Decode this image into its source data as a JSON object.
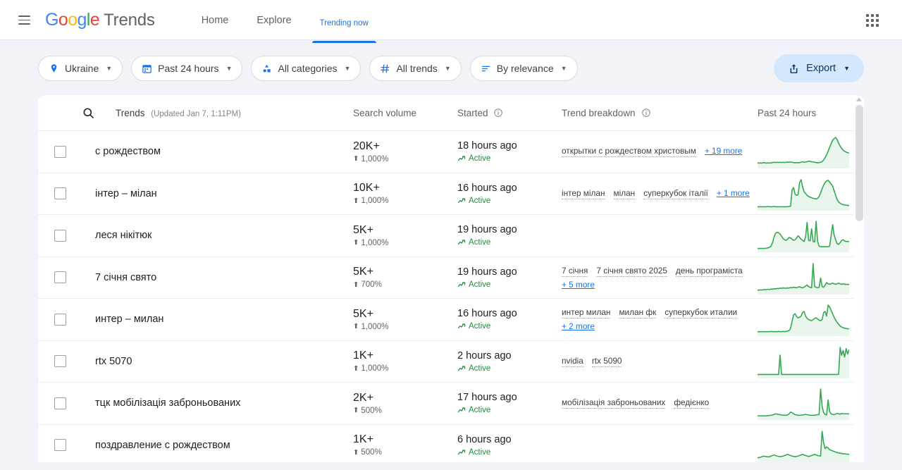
{
  "header": {
    "menu_icon": "hamburger-menu-icon",
    "logo_text": "Google",
    "logo_suffix": "Trends",
    "apps_icon": "apps-grid-icon",
    "nav": [
      {
        "label": "Home",
        "active": false
      },
      {
        "label": "Explore",
        "active": false
      },
      {
        "label": "Trending now",
        "active": true
      }
    ]
  },
  "filters": {
    "chips": [
      {
        "label": "Ukraine",
        "icon": "location-pin-icon"
      },
      {
        "label": "Past 24 hours",
        "icon": "calendar-icon"
      },
      {
        "label": "All categories",
        "icon": "categories-icon"
      },
      {
        "label": "All trends",
        "icon": "hash-icon"
      },
      {
        "label": "By relevance",
        "icon": "sort-icon"
      }
    ],
    "export": {
      "label": "Export",
      "icon": "export-upload-icon"
    }
  },
  "table": {
    "search_icon": "search-icon",
    "columns": {
      "trends": "Trends",
      "updated": "(Updated Jan 7, 1:11PM)",
      "search_volume": "Search volume",
      "started": "Started",
      "trend_breakdown": "Trend breakdown",
      "timeframe": "Past 24 hours"
    },
    "rows": [
      {
        "term": "с рождеством",
        "volume": "20K+",
        "change": "1,000%",
        "started": "18 hours ago",
        "status": "Active",
        "breakdown": [
          "открытки с рождеством христовым"
        ],
        "more": "+ 19 more",
        "spark": [
          12,
          11,
          12,
          11,
          13,
          12,
          11,
          12,
          11,
          12,
          13,
          14,
          13,
          14,
          13,
          14,
          13,
          14,
          13,
          14,
          15,
          14,
          15,
          14,
          13,
          12,
          13,
          12,
          13,
          14,
          16,
          14,
          15,
          16,
          18,
          17,
          16,
          15,
          14,
          13,
          12,
          13,
          14,
          16,
          22,
          30,
          40,
          52,
          66,
          78,
          90,
          96,
          100,
          92,
          80,
          70,
          62,
          56,
          52,
          49,
          47,
          46
        ]
      },
      {
        "term": "інтер – мілан",
        "volume": "10K+",
        "change": "1,000%",
        "started": "16 hours ago",
        "status": "Active",
        "breakdown": [
          "інтер мілан",
          "мілан",
          "суперкубок італії"
        ],
        "more": "+ 1 more",
        "spark": [
          6,
          6,
          6,
          6,
          6,
          6,
          6,
          7,
          6,
          6,
          6,
          7,
          6,
          6,
          6,
          6,
          6,
          6,
          6,
          6,
          6,
          7,
          8,
          62,
          70,
          48,
          44,
          46,
          86,
          96,
          72,
          56,
          50,
          44,
          40,
          38,
          36,
          34,
          33,
          32,
          34,
          40,
          52,
          66,
          78,
          86,
          92,
          94,
          88,
          82,
          74,
          60,
          44,
          30,
          22,
          18,
          15,
          13,
          12,
          11,
          11,
          10
        ]
      },
      {
        "term": "леся нікітюк",
        "volume": "5K+",
        "change": "1,000%",
        "started": "19 hours ago",
        "status": "Active",
        "breakdown": [],
        "more": "",
        "spark": [
          6,
          6,
          6,
          6,
          6,
          6,
          7,
          8,
          10,
          14,
          26,
          46,
          58,
          62,
          60,
          56,
          48,
          40,
          36,
          34,
          38,
          44,
          42,
          38,
          34,
          36,
          42,
          50,
          44,
          38,
          34,
          30,
          46,
          96,
          34,
          32,
          74,
          30,
          28,
          100,
          30,
          14,
          12,
          12,
          12,
          12,
          12,
          12,
          14,
          50,
          88,
          52,
          36,
          22,
          20,
          26,
          34,
          36,
          32,
          30,
          30,
          30
        ]
      },
      {
        "term": "7 січня свято",
        "volume": "5K+",
        "change": "700%",
        "started": "19 hours ago",
        "status": "Active",
        "breakdown": [
          "7 січня",
          "7 січня свято 2025",
          "день програміста"
        ],
        "more": "+ 5 more",
        "spark": [
          8,
          8,
          9,
          8,
          10,
          9,
          10,
          11,
          10,
          12,
          11,
          13,
          12,
          14,
          13,
          15,
          14,
          16,
          15,
          14,
          16,
          15,
          17,
          16,
          18,
          17,
          16,
          18,
          20,
          17,
          16,
          18,
          22,
          26,
          20,
          18,
          16,
          100,
          20,
          18,
          16,
          18,
          50,
          20,
          18,
          26,
          34,
          30,
          28,
          30,
          32,
          30,
          28,
          30,
          32,
          30,
          28,
          30,
          28,
          28,
          28,
          28
        ]
      },
      {
        "term": "интер – милан",
        "volume": "5K+",
        "change": "1,000%",
        "started": "16 hours ago",
        "status": "Active",
        "breakdown": [
          "интер милан",
          "милан фк",
          "суперкубок италии"
        ],
        "more": "+ 2 more",
        "spark": [
          8,
          8,
          8,
          8,
          8,
          8,
          8,
          8,
          8,
          9,
          8,
          8,
          8,
          8,
          9,
          8,
          8,
          9,
          8,
          9,
          10,
          12,
          20,
          44,
          66,
          70,
          60,
          56,
          58,
          62,
          74,
          78,
          62,
          54,
          50,
          48,
          46,
          50,
          54,
          56,
          52,
          48,
          46,
          50,
          74,
          78,
          62,
          100,
          94,
          82,
          70,
          58,
          48,
          40,
          34,
          28,
          24,
          22,
          20,
          19,
          18,
          18
        ]
      },
      {
        "term": "rtx 5070",
        "volume": "1K+",
        "change": "1,000%",
        "started": "2 hours ago",
        "status": "Active",
        "breakdown": [
          "nvidia",
          "rtx 5090"
        ],
        "more": "",
        "spark": [
          6,
          6,
          6,
          6,
          6,
          6,
          6,
          6,
          6,
          6,
          6,
          6,
          6,
          6,
          6,
          70,
          6,
          6,
          6,
          6,
          6,
          6,
          6,
          6,
          6,
          6,
          6,
          6,
          6,
          6,
          6,
          6,
          6,
          6,
          6,
          6,
          6,
          6,
          6,
          6,
          6,
          6,
          6,
          6,
          6,
          6,
          6,
          6,
          6,
          6,
          6,
          6,
          6,
          6,
          7,
          96,
          70,
          86,
          64,
          92,
          74,
          88
        ]
      },
      {
        "term": "тцк мобілізація заброньованих",
        "volume": "2K+",
        "change": "500%",
        "started": "17 hours ago",
        "status": "Active",
        "breakdown": [
          "мобілізація заброньованих",
          "федієнко"
        ],
        "more": "",
        "spark": [
          7,
          7,
          7,
          7,
          7,
          7,
          7,
          8,
          8,
          9,
          10,
          12,
          14,
          13,
          12,
          11,
          10,
          9,
          9,
          9,
          10,
          14,
          20,
          18,
          14,
          11,
          10,
          9,
          9,
          9,
          10,
          11,
          12,
          11,
          10,
          9,
          9,
          9,
          9,
          10,
          11,
          12,
          100,
          40,
          18,
          12,
          10,
          62,
          22,
          14,
          12,
          11,
          13,
          16,
          14,
          13,
          15,
          14,
          14,
          14,
          14,
          14
        ]
      },
      {
        "term": "поздравление с рождеством",
        "volume": "1K+",
        "change": "500%",
        "started": "6 hours ago",
        "status": "Active",
        "breakdown": [],
        "more": "",
        "spark": [
          8,
          9,
          10,
          12,
          14,
          13,
          12,
          11,
          12,
          14,
          16,
          18,
          16,
          14,
          13,
          12,
          13,
          14,
          16,
          18,
          20,
          18,
          16,
          14,
          13,
          12,
          13,
          14,
          16,
          18,
          20,
          18,
          16,
          14,
          13,
          14,
          16,
          18,
          20,
          18,
          16,
          15,
          14,
          100,
          60,
          40,
          46,
          42,
          36,
          34,
          32,
          30,
          28,
          26,
          25,
          24,
          23,
          22,
          22,
          21,
          21,
          20
        ]
      }
    ]
  },
  "colors": {
    "accent": "#1a73e8",
    "spark_line": "#34a853",
    "active_green": "#1e8e3e",
    "export_bg": "#d3e7fd",
    "page_bg": "#f1f3f8"
  }
}
